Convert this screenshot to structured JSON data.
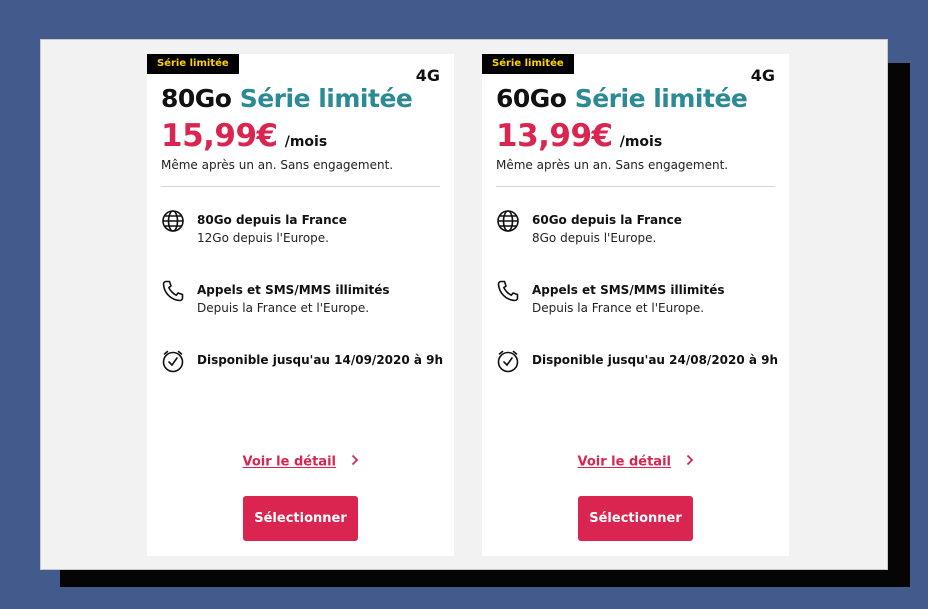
{
  "colors": {
    "brand": "#d9254f",
    "accent": "#2c8a94",
    "badge_bg": "#000000",
    "badge_text": "#ffd100"
  },
  "offers": [
    {
      "badge": "Série limitée",
      "network": "4G",
      "title_data": "80Go",
      "title_accent": "Série limitée",
      "price": "15,99€",
      "period": "/mois",
      "subtitle": "Même après un an. Sans engagement.",
      "features": [
        {
          "icon": "globe-icon",
          "line1": "80Go depuis la France",
          "line2": "12Go depuis l'Europe."
        },
        {
          "icon": "phone-icon",
          "line1": "Appels et SMS/MMS illimités",
          "line2": "Depuis la France et l'Europe."
        },
        {
          "icon": "clock-icon",
          "line1": "Disponible jusqu'au 14/09/2020 à 9h",
          "line2": ""
        }
      ],
      "detail_link": "Voir le détail",
      "select_label": "Sélectionner"
    },
    {
      "badge": "Série limitée",
      "network": "4G",
      "title_data": "60Go",
      "title_accent": "Série limitée",
      "price": "13,99€",
      "period": "/mois",
      "subtitle": "Même après un an. Sans engagement.",
      "features": [
        {
          "icon": "globe-icon",
          "line1": "60Go depuis la France",
          "line2": "8Go depuis l'Europe."
        },
        {
          "icon": "phone-icon",
          "line1": "Appels et SMS/MMS illimités",
          "line2": "Depuis la France et l'Europe."
        },
        {
          "icon": "clock-icon",
          "line1": "Disponible jusqu'au 24/08/2020 à 9h",
          "line2": ""
        }
      ],
      "detail_link": "Voir le détail",
      "select_label": "Sélectionner"
    }
  ]
}
